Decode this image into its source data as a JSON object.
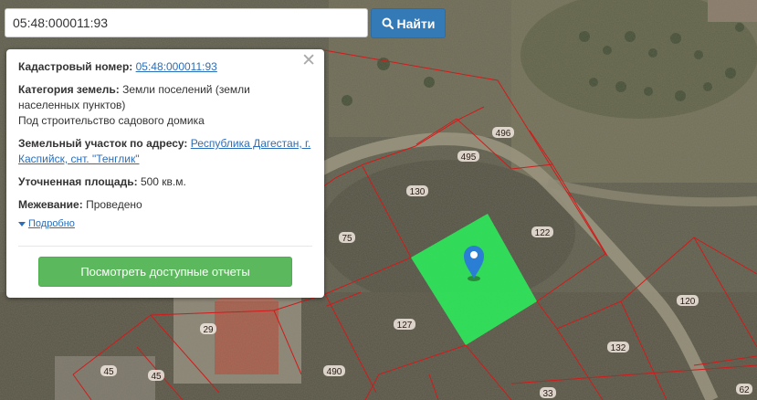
{
  "search": {
    "value": "05:48:000011:93",
    "button_label": "Найти",
    "button_icon": "search-icon"
  },
  "popup": {
    "cadastral_label": "Кадастровый номер:",
    "cadastral_value": "05:48:000011:93",
    "category_label": "Категория земель:",
    "category_value": "Земли поселений (земли населенных пунктов)",
    "purpose": "Под строительство садового домика",
    "address_label": "Земельный участок по адресу:",
    "address_value": "Республика Дагестан, г. Каспийск, снт. \"Тенглик\"",
    "area_label": "Уточненная площадь:",
    "area_value": "500 кв.м.",
    "survey_label": "Межевание:",
    "survey_value": "Проведено",
    "details_link": "Подробно",
    "reports_button": "Посмотреть доступные отчеты",
    "close_icon": "close-icon"
  },
  "map": {
    "parcel_labels": [
      "496",
      "495",
      "130",
      "122",
      "75",
      "127",
      "132",
      "120",
      "29",
      "45",
      "45",
      "490",
      "33",
      "62"
    ],
    "highlight_color": "#2ee65a",
    "boundary_color": "#d11b1b",
    "marker_color": "#2a7fd4"
  }
}
